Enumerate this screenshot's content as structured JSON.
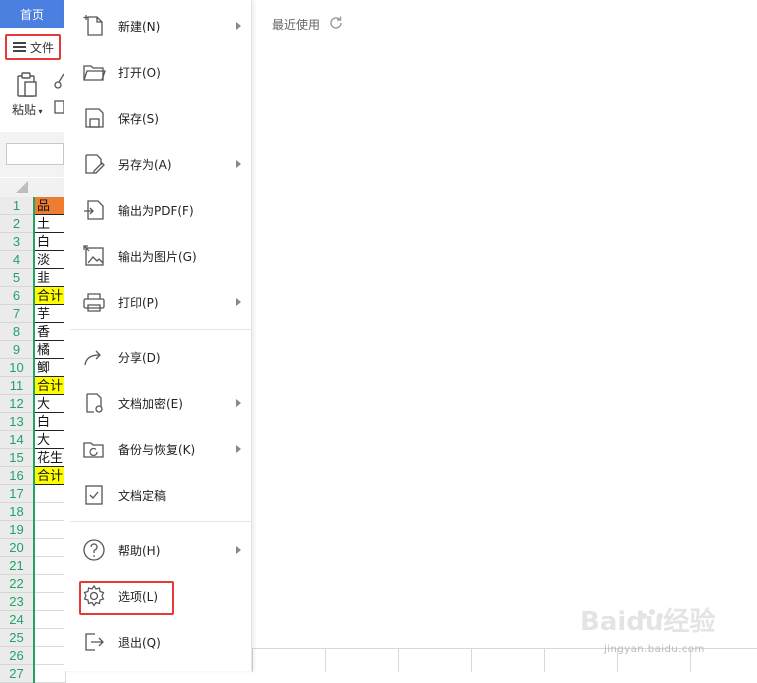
{
  "app": {
    "home_tab": "首页",
    "file_button": "文件",
    "paste_label": "粘贴"
  },
  "sheet": {
    "row_numbers": [
      "1",
      "2",
      "3",
      "4",
      "5",
      "6",
      "7",
      "8",
      "9",
      "10",
      "11",
      "12",
      "13",
      "14",
      "15",
      "16",
      "17",
      "18",
      "19",
      "20",
      "21",
      "22",
      "23",
      "24",
      "25",
      "26",
      "27"
    ],
    "column_a": [
      {
        "text": "品",
        "style": "orange"
      },
      {
        "text": "土",
        "style": ""
      },
      {
        "text": "白",
        "style": ""
      },
      {
        "text": "淡",
        "style": ""
      },
      {
        "text": "韭",
        "style": ""
      },
      {
        "text": "合计",
        "style": "yellow"
      },
      {
        "text": "芋",
        "style": ""
      },
      {
        "text": "香",
        "style": ""
      },
      {
        "text": "橘",
        "style": ""
      },
      {
        "text": "鲫",
        "style": ""
      },
      {
        "text": "合计",
        "style": "yellow"
      },
      {
        "text": "大",
        "style": ""
      },
      {
        "text": "白",
        "style": ""
      },
      {
        "text": "大",
        "style": ""
      },
      {
        "text": "花生",
        "style": ""
      },
      {
        "text": "合计",
        "style": "yellow"
      },
      {
        "text": "",
        "style": "empty"
      },
      {
        "text": "",
        "style": "empty"
      },
      {
        "text": "",
        "style": "empty"
      },
      {
        "text": "",
        "style": "empty"
      },
      {
        "text": "",
        "style": "empty"
      },
      {
        "text": "",
        "style": "empty"
      },
      {
        "text": "",
        "style": "empty"
      },
      {
        "text": "",
        "style": "empty"
      },
      {
        "text": "",
        "style": "empty"
      },
      {
        "text": "",
        "style": "empty"
      },
      {
        "text": "",
        "style": "empty"
      }
    ]
  },
  "menu": {
    "items": [
      {
        "label": "新建(N)",
        "icon": "new-file-icon",
        "submenu": true
      },
      {
        "label": "打开(O)",
        "icon": "folder-open-icon",
        "submenu": false
      },
      {
        "label": "保存(S)",
        "icon": "save-icon",
        "submenu": false
      },
      {
        "label": "另存为(A)",
        "icon": "save-as-icon",
        "submenu": true
      },
      {
        "label": "输出为PDF(F)",
        "icon": "export-pdf-icon",
        "submenu": false
      },
      {
        "label": "输出为图片(G)",
        "icon": "export-image-icon",
        "submenu": false
      },
      {
        "label": "打印(P)",
        "icon": "print-icon",
        "submenu": true
      },
      {
        "label": "分享(D)",
        "icon": "share-icon",
        "submenu": false
      },
      {
        "label": "文档加密(E)",
        "icon": "encrypt-icon",
        "submenu": true
      },
      {
        "label": "备份与恢复(K)",
        "icon": "backup-icon",
        "submenu": true
      },
      {
        "label": "文档定稿",
        "icon": "finalize-icon",
        "submenu": false
      },
      {
        "label": "帮助(H)",
        "icon": "help-icon",
        "submenu": true
      },
      {
        "label": "选项(L)",
        "icon": "gear-icon",
        "submenu": false
      },
      {
        "label": "退出(Q)",
        "icon": "exit-icon",
        "submenu": false
      }
    ]
  },
  "recent": {
    "title": "最近使用"
  },
  "watermark": {
    "brand": "Baidu经验",
    "url": "jingyan.baidu.com"
  },
  "colors": {
    "home_tab": "#4b7fe0",
    "highlight_border": "#e53935",
    "header_orange": "#ed7d31",
    "total_yellow": "#ffff00",
    "row_number_green": "#21a366"
  }
}
